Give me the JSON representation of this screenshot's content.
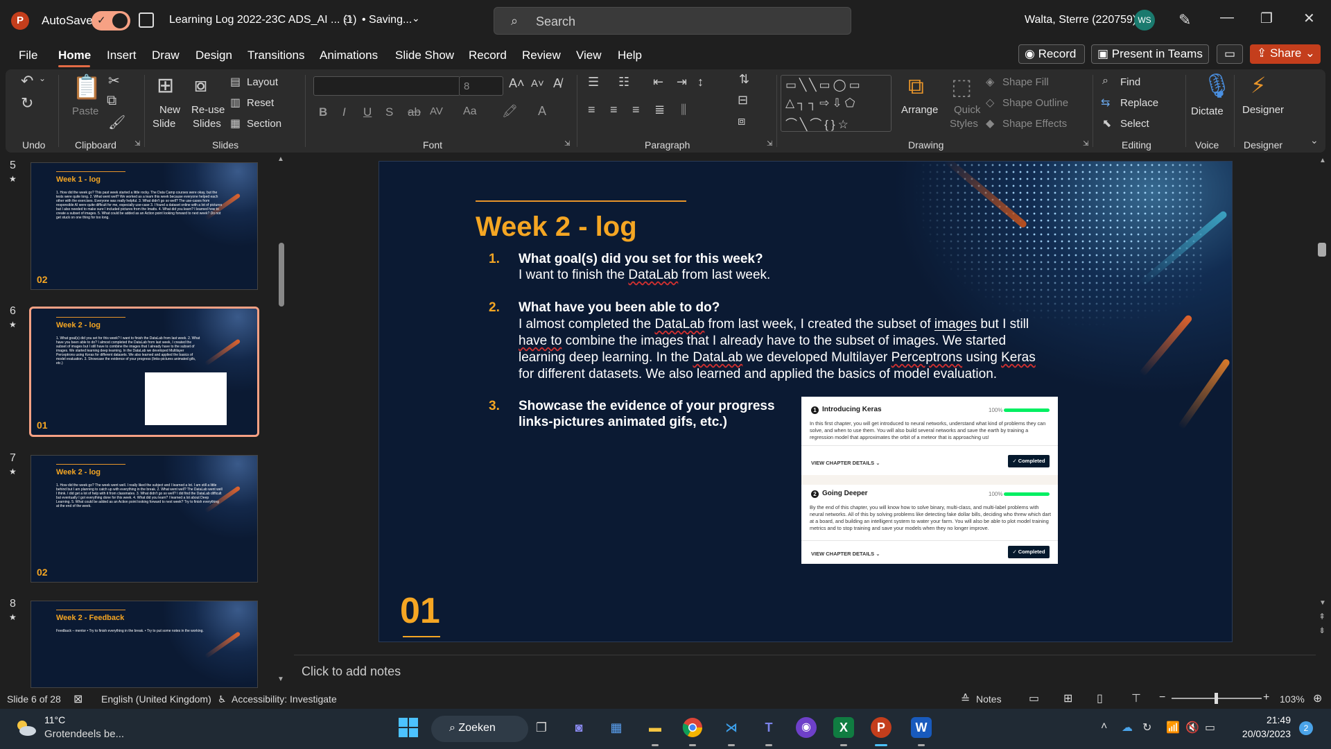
{
  "titlebar": {
    "app_icon": "P",
    "autosave_label": "AutoSave",
    "autosave_on": true,
    "doc_title": "Learning Log 2022-23C ADS_AI ... (1)",
    "save_status": "• Saving...",
    "search_placeholder": "Search",
    "user_name": "Walta, Sterre (220759)",
    "user_initials": "WS",
    "icons": [
      "save-icon",
      "share-people-icon",
      "pen-icon",
      "minimize-icon",
      "restore-icon",
      "close-icon"
    ]
  },
  "tabs": [
    "File",
    "Home",
    "Insert",
    "Draw",
    "Design",
    "Transitions",
    "Animations",
    "Slide Show",
    "Record",
    "Review",
    "View",
    "Help"
  ],
  "active_tab": "Home",
  "top_buttons": {
    "record": "Record",
    "present": "Present in Teams",
    "share": "Share"
  },
  "ribbon": {
    "groups": {
      "undo": "Undo",
      "clipboard": "Clipboard",
      "slides": "Slides",
      "font": "Font",
      "paragraph": "Paragraph",
      "drawing": "Drawing",
      "editing": "Editing",
      "voice": "Voice",
      "designer": "Designer"
    },
    "paste": "Paste",
    "new_slide": [
      "New",
      "Slide"
    ],
    "reuse_slides": [
      "Re-use",
      "Slides"
    ],
    "layout": "Layout",
    "reset": "Reset",
    "section": "Section",
    "font_size": "8",
    "arrange": "Arrange",
    "quick_styles": [
      "Quick",
      "Styles"
    ],
    "shape_fill": "Shape Fill",
    "shape_outline": "Shape Outline",
    "shape_effects": "Shape Effects",
    "find": "Find",
    "replace": "Replace",
    "select": "Select",
    "dictate": "Dictate",
    "designer": "Designer"
  },
  "thumbnails": [
    {
      "num": "5",
      "title": "Week 1 - log",
      "footer": "02",
      "body": "1. How did the week go? This past week started a little rocky. The Data Camp courses were okay, but the tests were quite long. 2. What went well? We worked as a team this week because everyone helped each other with the exercises. Everyone was really helpful. 3. What didn't go so well? The use-cases from responsible AI were quite difficult for me, especially use-case 3. I found a dataset online with a lot of pictures but I also needed to make sure I included pictures from the Imatts. 4. What did you learn? I learned how to create a subset of images. 5. What could be added as an Action point looking forward to next week? Do not get stuck on one thing for too long."
    },
    {
      "num": "6",
      "title": "Week 2 - log",
      "footer": "01",
      "body": "1. What goal(s) did you set for this week? I want to finish the DataLab from last week. 2. What have you been able to do? I almost completed the DataLab from last week, I created the subset of images but I still have to combine the images that I already have to the subset of images. We started learning deep learning. In the DataLab we developed Multilayer Perceptrons using Keras for different datasets. We also learned and applied the basics of model evaluation. 3. Showcase the evidence of your progress (links-pictures animated gifs, etc.)",
      "selected": true
    },
    {
      "num": "7",
      "title": "Week 2 - log",
      "footer": "02",
      "body": "1. How did the week go? The week went well. I really liked the subject and I learned a lot. I am still a little behind but I am planning to catch up with everything in the break. 2. What went well? The DataLab went well I think. I did get a lot of help with it from classmates. 3. What didn't go so well? I did find the DataLab difficult but eventually I got everything done for this week. 4. What did you learn? I learned a lot about Deep Learning. 5. What could be added as an Action point looking forward to next week? Try to finish everything at the end of the week."
    },
    {
      "num": "8",
      "title": "Week 2 - Feedback",
      "footer": "",
      "body": "Feedback – mentor • Try to finish everything in the break. • Try to put some notes in the working."
    }
  ],
  "slide": {
    "title": "Week 2 - log",
    "items": [
      {
        "num": "1.",
        "heading": "What goal(s) did you set for this week?",
        "body": "I want to finish the DataLab from last week."
      },
      {
        "num": "2.",
        "heading": "What have you been able to do?",
        "body_lines": [
          "I almost completed the DataLab from last week, I created the subset of images but I still",
          "have to combine the images that I already have to the subset of images. We started",
          "learning deep learning. In the DataLab we developed Multilayer Perceptrons using Keras",
          "for different datasets. We also learned and applied the basics of model evaluation."
        ]
      },
      {
        "num": "3.",
        "heading_lines": [
          "Showcase the evidence of your progress",
          "links-pictures animated gifs, etc.)"
        ]
      }
    ],
    "footer_num": "01",
    "embedded": {
      "cards": [
        {
          "num": "1",
          "title": "Introducing Keras",
          "progress": "100%",
          "progress_value": 1.0,
          "desc": "In this first chapter, you will get introduced to neural networks, understand what kind of problems they can solve, and when to use them. You will also build several networks and save the earth by training a regression model that approximates the orbit of a meteor that is approaching us!",
          "details": "VIEW CHAPTER DETAILS",
          "status": "✓  Completed"
        },
        {
          "num": "2",
          "title": "Going Deeper",
          "progress": "100%",
          "progress_value": 1.0,
          "desc": "By the end of this chapter, you will know how to solve binary, multi-class, and multi-label problems with neural networks. All of this by solving problems like detecting fake dollar bills, deciding who threw which dart at a board, and building an intelligent system to water your farm. You will also be able to plot model training metrics and to stop training and save your models when they no longer improve.",
          "details": "VIEW CHAPTER DETAILS",
          "status": "✓  Completed"
        }
      ]
    }
  },
  "notes_placeholder": "Click to add notes",
  "status": {
    "slide_count": "Slide 6 of 28",
    "language": "English (United Kingdom)",
    "accessibility": "Accessibility: Investigate",
    "notes": "Notes",
    "zoom": "103%"
  },
  "taskbar": {
    "temp": "11°C",
    "condition": "Grotendeels be...",
    "search": "Zoeken",
    "time": "21:49",
    "date": "20/03/2023",
    "notifications": "2"
  },
  "colors": {
    "accent": "#c43e1c",
    "slide_bg": "#0b1a33",
    "slide_orange": "#f5a623",
    "tab_underline": "#e36b45"
  }
}
